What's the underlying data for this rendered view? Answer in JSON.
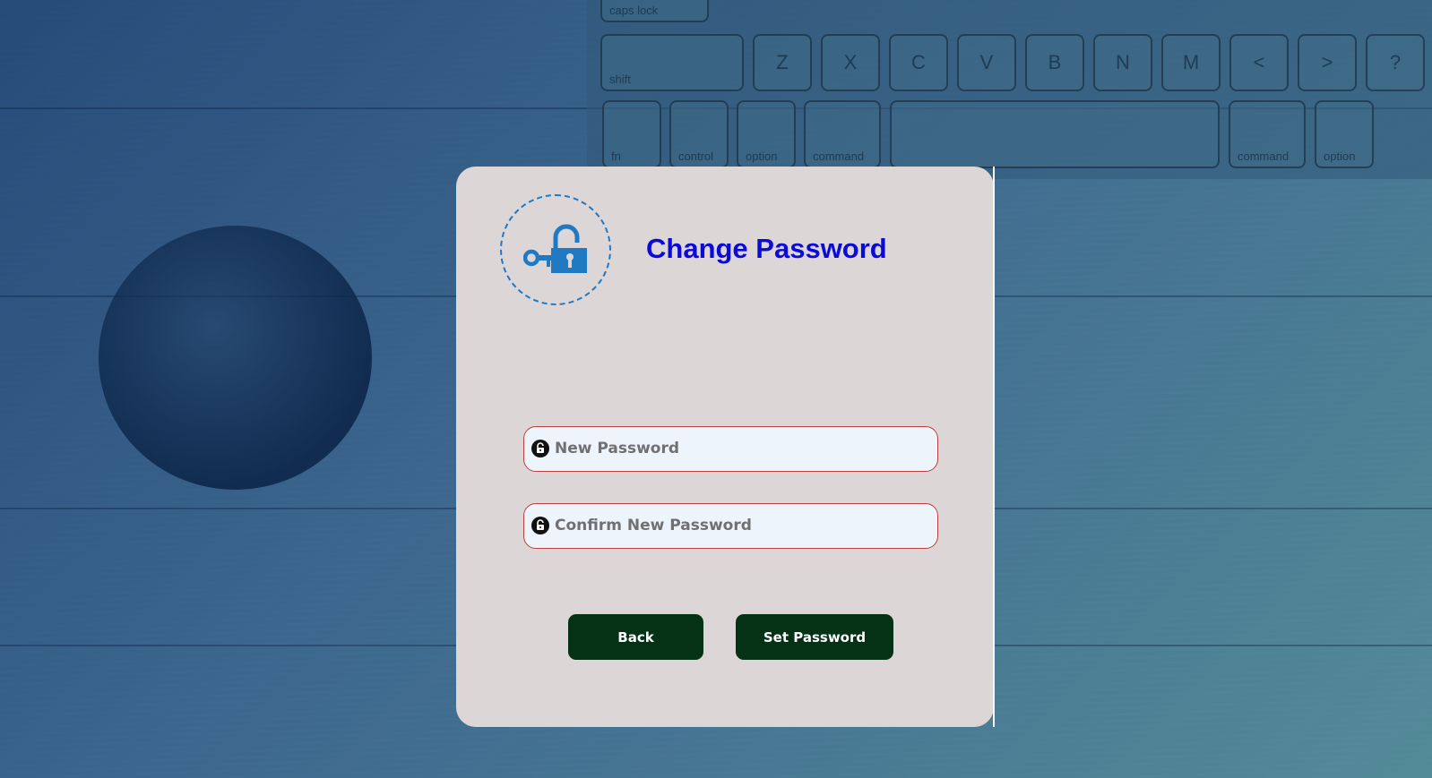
{
  "page": {
    "title": "Change Password"
  },
  "form": {
    "new_password": {
      "value": "",
      "placeholder": "New Password"
    },
    "confirm_password": {
      "value": "",
      "placeholder": "Confirm New Password"
    }
  },
  "buttons": {
    "back_label": "Back",
    "set_password_label": "Set Password"
  },
  "background": {
    "keyboard_keys": [
      "caps lock",
      "shift",
      "Z",
      "X",
      "C",
      "V",
      "B",
      "N",
      "M",
      "<",
      ">",
      "?",
      "fn",
      "control",
      "option",
      "command",
      "command",
      "option"
    ]
  },
  "icons": {
    "logo": "key-lock-icon",
    "field_icon": "lock-icon"
  },
  "colors": {
    "title": "#0b0bd9",
    "button_bg": "#053115",
    "card_bg": "#ddd6d6",
    "field_border": "#b94040",
    "logo_blue": "#1f79c3"
  }
}
